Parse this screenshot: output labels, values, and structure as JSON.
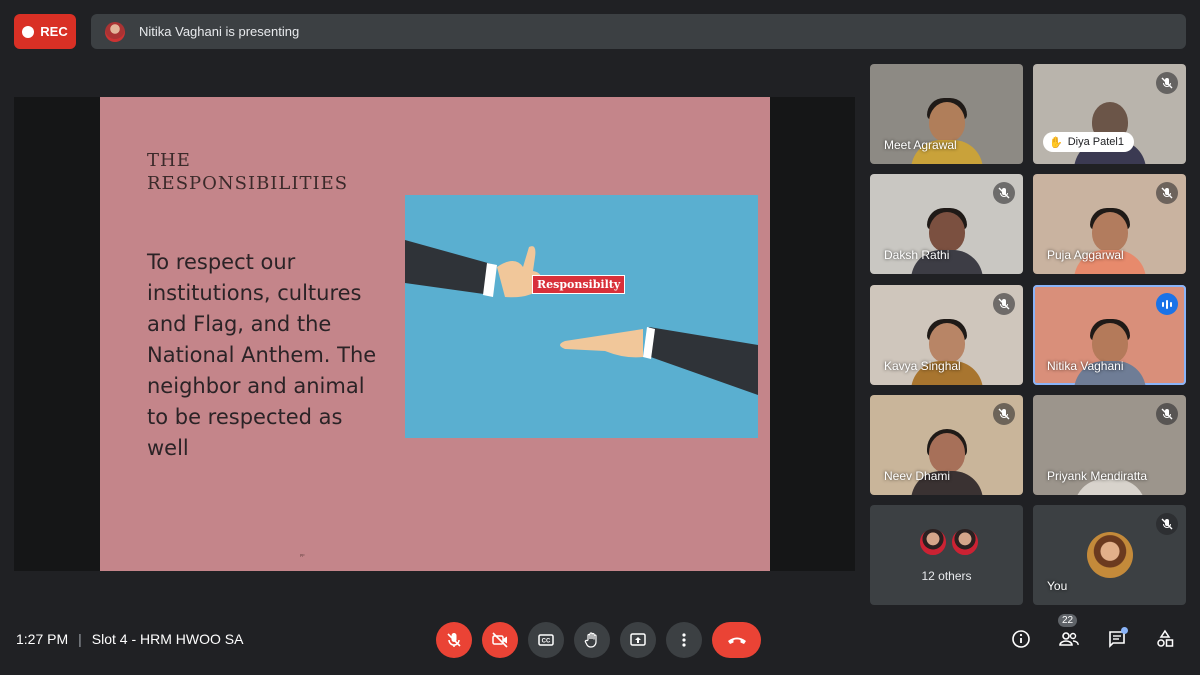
{
  "recording": {
    "label": "REC"
  },
  "presenting_banner": {
    "text": "Nitika Vaghani is presenting"
  },
  "slide": {
    "title_line1": "THE",
    "title_line2": "RESPONSIBILITIES",
    "body": "To respect our institutions, cultures and Flag, and the National Anthem. The neighbor and animal to be respected as well",
    "image_tag": "Responsibilty",
    "footnote": "pp"
  },
  "participants": [
    {
      "name": "Meet Agrawal",
      "muted": false
    },
    {
      "name": "Diya Patel1",
      "muted": true,
      "hand_raised": true
    },
    {
      "name": "Daksh Rathi",
      "muted": true
    },
    {
      "name": "Puja Aggarwal",
      "muted": true
    },
    {
      "name": "Kavya Singhal",
      "muted": true
    },
    {
      "name": "Nitika Vaghani",
      "speaking": true
    },
    {
      "name": "Neev Dhami",
      "muted": true
    },
    {
      "name": "Priyank Mendiratta",
      "muted": true
    }
  ],
  "others": {
    "label": "12 others"
  },
  "self_tile": {
    "name": "You",
    "muted": true
  },
  "footer": {
    "time": "1:27 PM",
    "separator": "|",
    "meeting_title": "Slot 4 - HRM HWOO SA",
    "people_count": "22"
  },
  "controls": [
    "microphone-off",
    "camera-off",
    "captions",
    "raise-hand",
    "present-screen",
    "more-options",
    "leave-call"
  ],
  "colors": {
    "accent_red": "#ea4335",
    "rec_red": "#d93025",
    "slide_bg": "#c4858a",
    "speaking_blue": "#1a73e8"
  }
}
